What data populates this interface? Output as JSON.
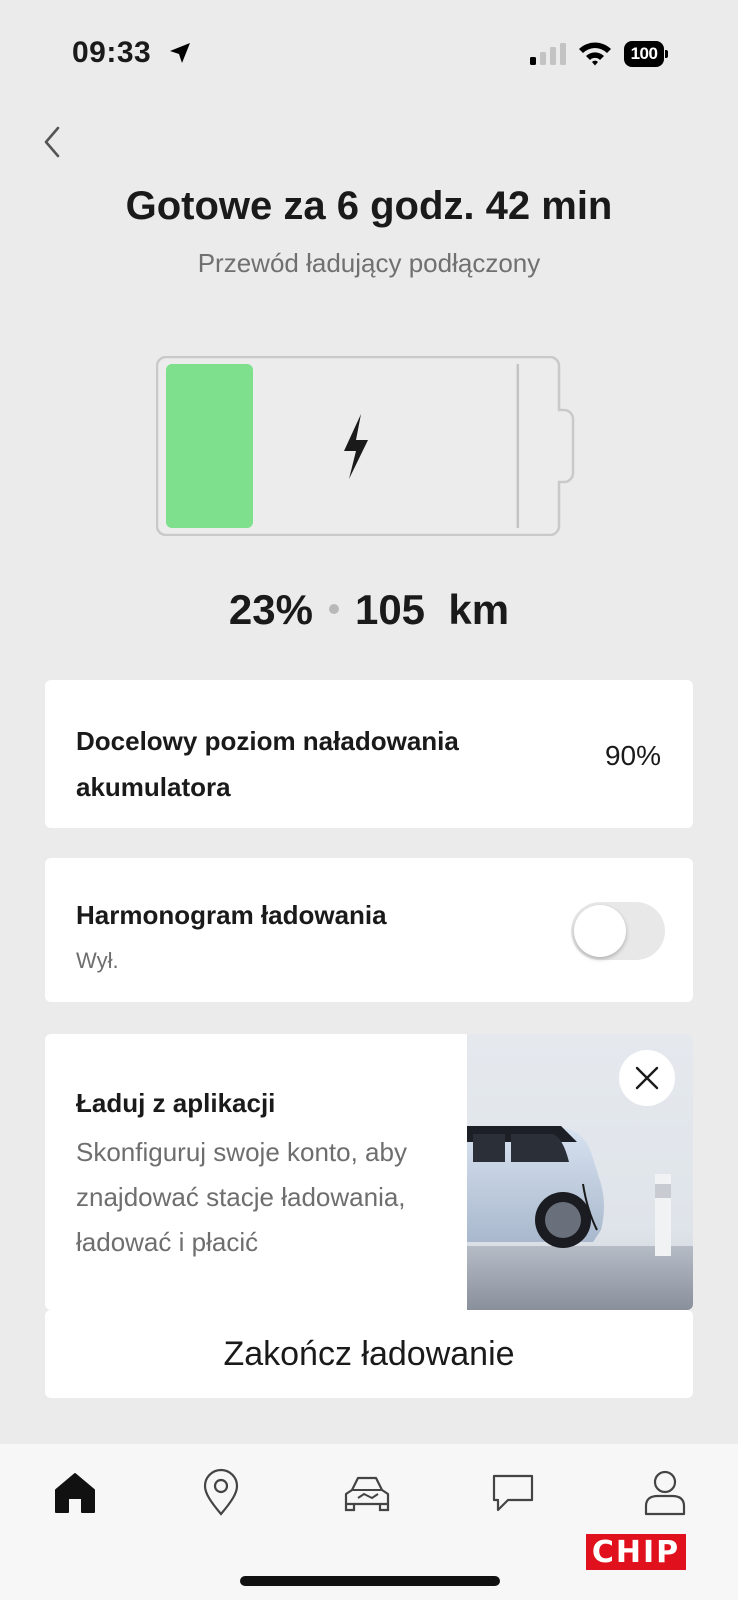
{
  "status_bar": {
    "time": "09:33",
    "battery_level": "100"
  },
  "header": {
    "title": "Gotowe za 6 godz. 42 min",
    "subtitle": "Przewód ładujący podłączony"
  },
  "charge": {
    "percent_text": "23%",
    "range_text": "105  km",
    "level_fraction": 0.23,
    "target_fraction": 0.9,
    "fill_color": "#7ee08d"
  },
  "target_card": {
    "label": "Docelowy poziom naładowania akumulatora",
    "value": "90%"
  },
  "schedule_card": {
    "label": "Harmonogram ładowania",
    "status": "Wył.",
    "toggle_on": false
  },
  "promo_card": {
    "title": "Ładuj z aplikacji",
    "body": "Skonfiguruj swoje konto, aby znajdować stacje ładowania, ładować i płacić"
  },
  "stop_button": {
    "label": "Zakończ ładowanie"
  },
  "tabbar": {
    "items": [
      "home-icon",
      "map-pin-icon",
      "car-icon",
      "chat-icon",
      "profile-icon"
    ],
    "active": "home-icon"
  },
  "watermark": {
    "text": "CHIP"
  }
}
